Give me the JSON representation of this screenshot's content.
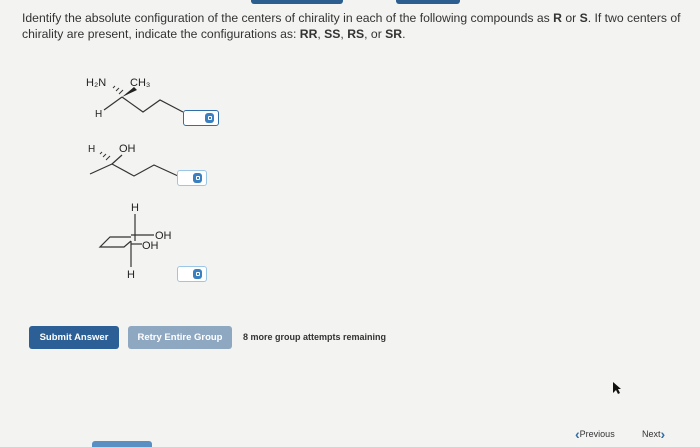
{
  "question": {
    "text_before": "Identify the absolute configuration of the centers of chirality in each of the following compounds as ",
    "r": "R",
    "or": " or ",
    "s": "S",
    "text_mid": ". If two centers of chirality are present, indicate the configurations as: ",
    "rr": "RR",
    "sep1": ", ",
    "ss": "SS",
    "sep2": ", ",
    "rs": "RS",
    "sep3": ", or ",
    "sr": "SR",
    "end": "."
  },
  "molecules": {
    "m1": {
      "nh2": "H₂N",
      "ch3": "CH₃",
      "h": "H"
    },
    "m2": {
      "h": "H",
      "oh": "OH"
    },
    "m3": {
      "h_top": "H",
      "oh1": "OH",
      "oh2": "OH",
      "h_bottom": "H"
    }
  },
  "answers": [
    {
      "value": "",
      "icon": "lock-icon"
    },
    {
      "value": "",
      "icon": "lock-icon"
    },
    {
      "value": "",
      "icon": "lock-icon"
    }
  ],
  "buttons": {
    "submit": "Submit Answer",
    "retry": "Retry Entire Group"
  },
  "attempts_text": "8 more group attempts remaining",
  "nav": {
    "previous": "Previous",
    "next": "Next"
  },
  "colors": {
    "primary": "#2b5f96",
    "secondary": "#8fa8c2",
    "accent": "#3a7fc0"
  }
}
